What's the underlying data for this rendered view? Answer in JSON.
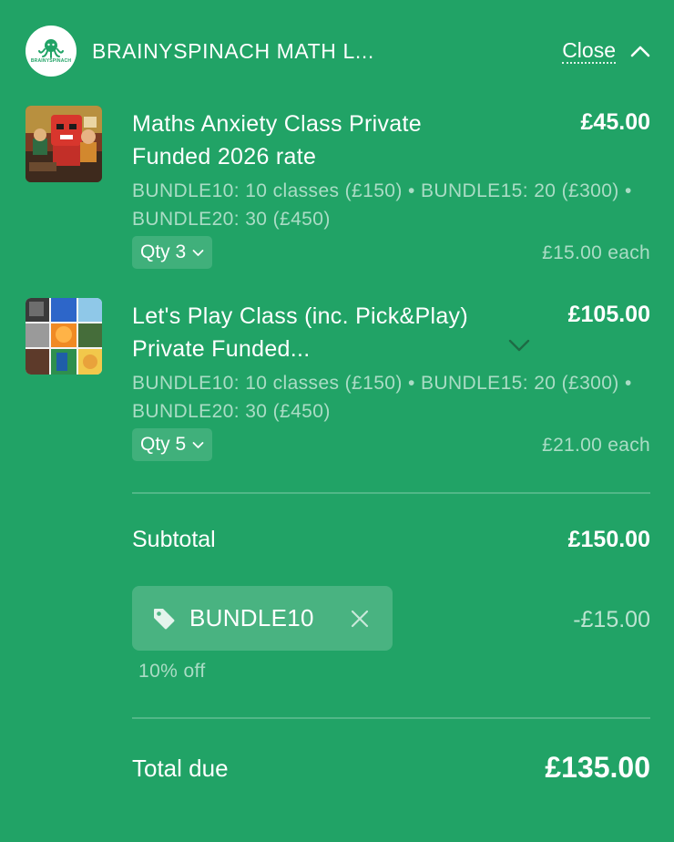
{
  "header": {
    "logo_text": "BRAINYSPINACH",
    "shop_name": "BRAINYSPINACH MATH L...",
    "close_label": "Close"
  },
  "items": [
    {
      "title": "Maths Anxiety Class Private Funded 2026 rate",
      "price": "£45.00",
      "description": "BUNDLE10: 10 classes (£150) • BUNDLE15: 20 (£300) • BUNDLE20: 30 (£450)",
      "qty_label": "Qty 3",
      "unit_price": "£15.00 each"
    },
    {
      "title": "Let's Play Class (inc. Pick&Play) Private Funded...",
      "price": "£105.00",
      "description": "BUNDLE10: 10 classes (£150) • BUNDLE15: 20 (£300) • BUNDLE20: 30 (£450)",
      "qty_label": "Qty 5",
      "unit_price": "£21.00 each"
    }
  ],
  "summary": {
    "subtotal_label": "Subtotal",
    "subtotal_value": "£150.00",
    "promo_code": "BUNDLE10",
    "discount_value": "-£15.00",
    "discount_note": "10% off",
    "total_label": "Total due",
    "total_value": "£135.00"
  },
  "colors": {
    "background": "#21a366",
    "text": "#ffffff"
  },
  "icons": {
    "header_collapse": "chevron-up-icon",
    "qty_caret": "chevron-down-icon",
    "item_expand": "chevron-down-icon",
    "promo_tag": "tag-icon",
    "promo_remove": "close-icon"
  }
}
